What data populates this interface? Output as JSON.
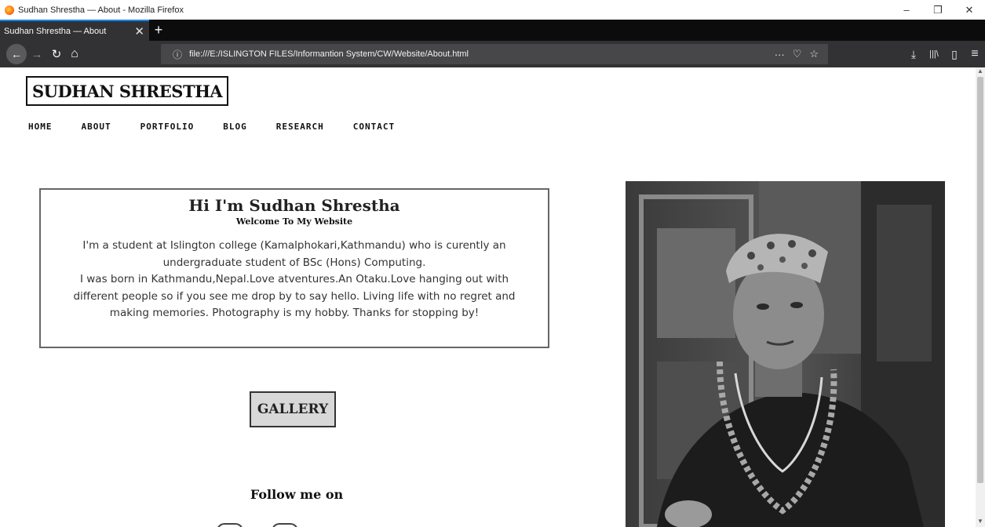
{
  "window": {
    "title": "Sudhan Shrestha — About - Mozilla Firefox",
    "controls": {
      "minimize": "–",
      "maximize": "❐",
      "close": "✕"
    }
  },
  "tabs": [
    {
      "label": "Sudhan Shrestha — About",
      "close": "✕",
      "active": true
    }
  ],
  "new_tab_label": "+",
  "nav": {
    "back": "←",
    "forward": "→",
    "reload": "↻",
    "home": "⌂",
    "url": "file:///E:/ISLINGTON FILES/Informantion System/CW/Website/About.html",
    "page_actions": "···",
    "pocket": "♡",
    "bookmark": "☆",
    "downloads": "⤓",
    "library": "|||\\",
    "sidebar": "▯",
    "menu": "≡"
  },
  "site": {
    "logo": "SUDHAN SHRESTHA",
    "menu": [
      "HOME",
      "ABOUT",
      "PORTFOLIO",
      "BLOG",
      "RESEARCH",
      "CONTACT"
    ],
    "intro": {
      "title": "Hi I'm Sudhan Shrestha",
      "subtitle": "Welcome To My Website",
      "paragraph1": "I'm a student at Islington college (Kamalphokari,Kathmandu) who is curently an undergraduate student of BSc (Hons) Computing.",
      "paragraph2": "I was born in Kathmandu,Nepal.Love atventures.An Otaku.Love hanging out with different people so if you see me drop by to say hello. Living life with no regret and making memories. Photography is my hobby. Thanks for stopping by!"
    },
    "gallery_label": "GALLERY",
    "follow_title": "Follow me on"
  },
  "colors": {
    "tab_accent": "#0a84ff",
    "toolbar": "#323234",
    "tabstrip": "#0c0c0d",
    "gallery_bg": "#d8d8d8"
  }
}
